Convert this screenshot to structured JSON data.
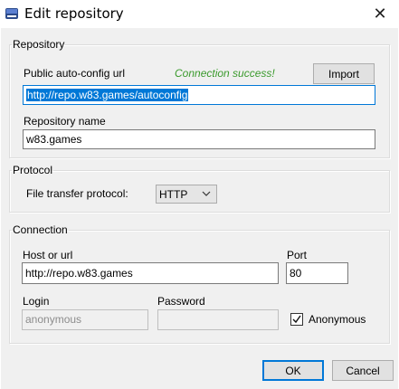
{
  "window": {
    "title": "Edit repository",
    "close_symbol": "✕"
  },
  "repository": {
    "legend": "Repository",
    "url_label": "Public auto-config url",
    "status": "Connection success!",
    "import_label": "Import",
    "url_value": "http://repo.w83.games/autoconfig",
    "name_label": "Repository name",
    "name_value": "w83.games"
  },
  "protocol": {
    "legend": "Protocol",
    "label": "File transfer protocol:",
    "selected": "HTTP"
  },
  "connection": {
    "legend": "Connection",
    "host_label": "Host or url",
    "host_value": "http://repo.w83.games",
    "port_label": "Port",
    "port_value": "80",
    "login_label": "Login",
    "login_value": "anonymous",
    "password_label": "Password",
    "password_value": "",
    "anonymous_label": "Anonymous",
    "anonymous_checked": true
  },
  "footer": {
    "ok_label": "OK",
    "cancel_label": "Cancel"
  },
  "colors": {
    "accent": "#0078d7",
    "success": "#3a9a2c"
  },
  "icons": {
    "app": "app-icon",
    "close": "close-icon",
    "dropdown": "chevron-down-icon",
    "check": "checkmark-icon"
  }
}
